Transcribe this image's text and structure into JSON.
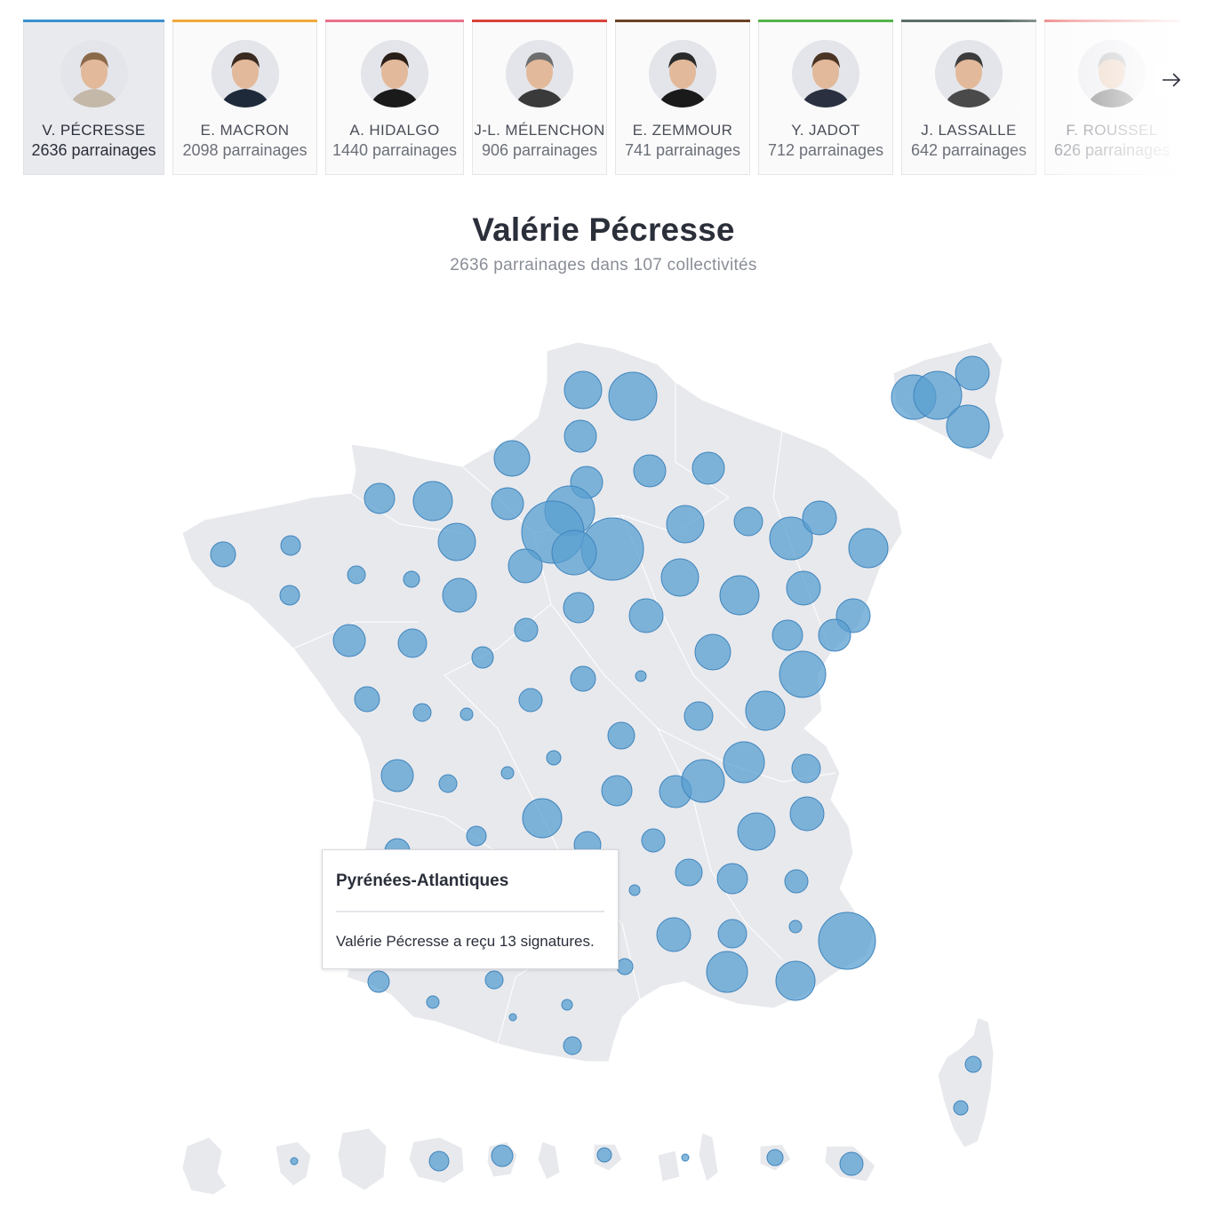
{
  "candidates": [
    {
      "name": "V. PÉCRESSE",
      "count": "2636 parrainages",
      "color": "#3a8fd0",
      "active": true
    },
    {
      "name": "E. MACRON",
      "count": "2098 parrainages",
      "color": "#f0a83a",
      "active": false
    },
    {
      "name": "A. HIDALGO",
      "count": "1440 parrainages",
      "color": "#e8718a",
      "active": false
    },
    {
      "name": "J-L. MÉLENCHON",
      "count": "906 parrainages",
      "color": "#d9433a",
      "active": false
    },
    {
      "name": "E. ZEMMOUR",
      "count": "741 parrainages",
      "color": "#6b4224",
      "active": false
    },
    {
      "name": "Y. JADOT",
      "count": "712 parrainages",
      "color": "#55b34a",
      "active": false
    },
    {
      "name": "J. LASSALLE",
      "count": "642 parrainages",
      "color": "#5d6e6a",
      "active": false
    },
    {
      "name": "F. ROUSSEL",
      "count": "626 parrainages",
      "color": "#e85a5a",
      "active": false
    }
  ],
  "next_icon": "arrow-right-icon",
  "selected": {
    "title": "Valérie Pécresse",
    "subtitle": "2636 parrainages dans 107 collectivités"
  },
  "tooltip": {
    "title": "Pyrénées-Atlantiques",
    "text": "Valérie Pécresse a reçu 13 signatures."
  },
  "bubble_color": "#5a9fd0"
}
